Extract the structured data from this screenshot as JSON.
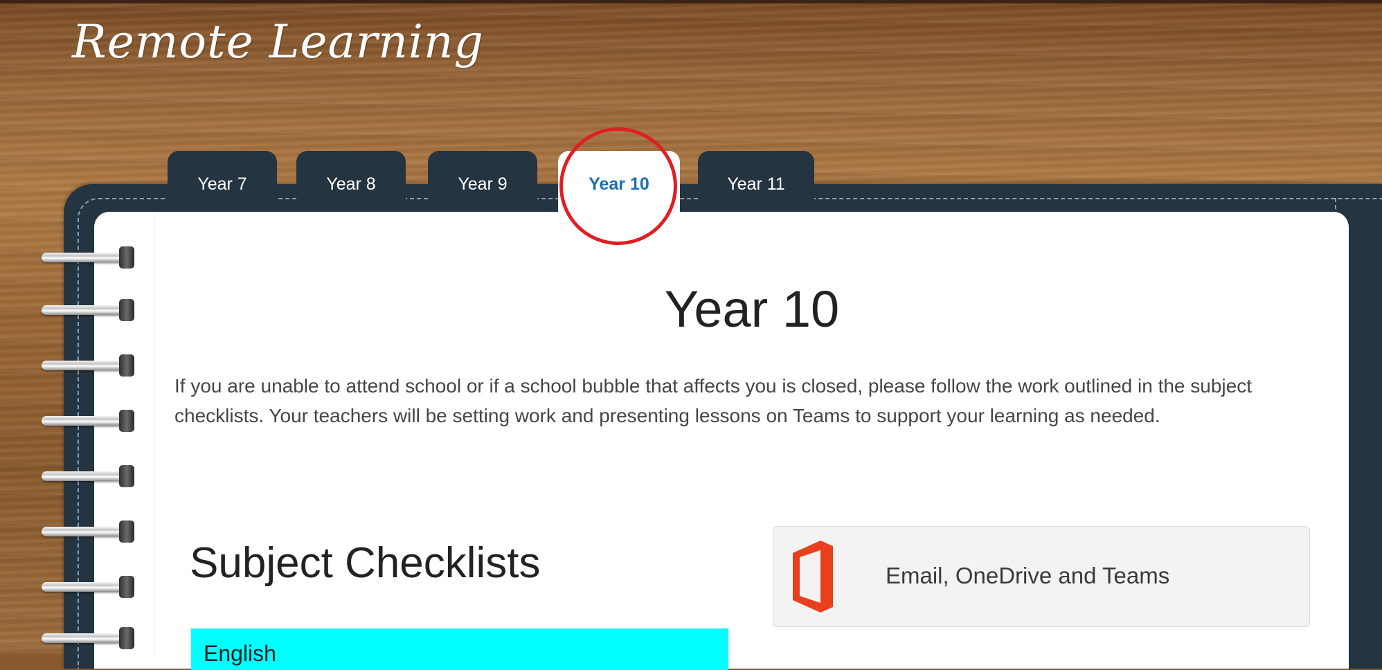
{
  "site": {
    "title": "Remote Learning"
  },
  "tabs": [
    {
      "label": "Year 7",
      "active": false
    },
    {
      "label": "Year 8",
      "active": false
    },
    {
      "label": "Year 9",
      "active": false
    },
    {
      "label": "Year 10",
      "active": true
    },
    {
      "label": "Year 11",
      "active": false
    }
  ],
  "content": {
    "heading": "Year 10",
    "intro": "If you are unable to attend school or if a school bubble that affects you is closed, please follow the work outlined in the subject checklists. Your teachers will be setting work and presenting lessons on Teams to support your learning as needed.",
    "checklists_heading": "Subject Checklists",
    "first_subject": "English",
    "office_card_label": "Email, OneDrive and Teams"
  },
  "colors": {
    "active_tab_text": "#1a6fb0",
    "subject_bar": "#00ffff",
    "office_icon": "#e8401c",
    "highlight_circle": "#e01e24",
    "notebook_cover": "#243440"
  }
}
